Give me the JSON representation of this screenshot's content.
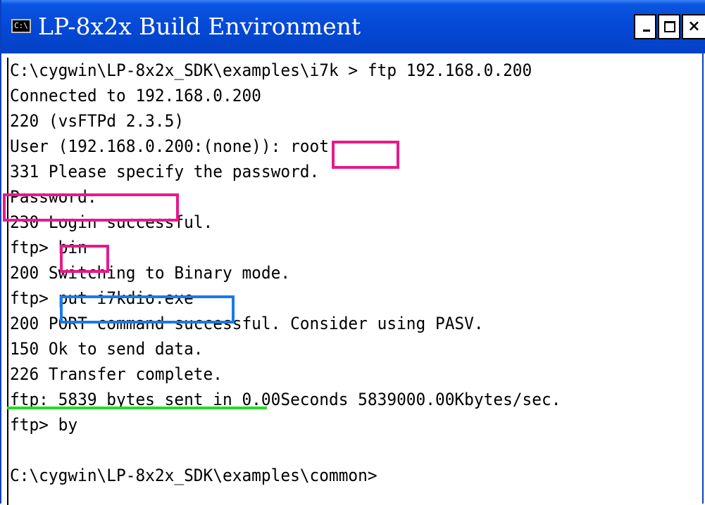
{
  "window": {
    "title": "LP-8x2x Build Environment",
    "icon": "console-icon",
    "icon_text": "C:\\",
    "buttons": {
      "minimize": "minimize-icon",
      "maximize": "maximize-icon",
      "close": "×"
    }
  },
  "terminal": {
    "lines": [
      "C:\\cygwin\\LP-8x2x_SDK\\examples\\i7k > ftp 192.168.0.200",
      "Connected to 192.168.0.200",
      "220 (vsFTPd 2.3.5)",
      "User (192.168.0.200:(none)): root",
      "331 Please specify the password.",
      "Password:",
      "230 Login successful.",
      "ftp> bin",
      "200 Switching to Binary mode.",
      "ftp> put i7kdio.exe",
      "200 PORT command successful. Consider using PASV.",
      "150 Ok to send data.",
      "226 Transfer complete.",
      "ftp: 5839 bytes sent in 0.00Seconds 5839000.00Kbytes/sec.",
      "ftp> by",
      "",
      "C:\\cygwin\\LP-8x2x_SDK\\examples\\common>"
    ]
  },
  "colors": {
    "titlebar": "#0548d6",
    "highlight_pink": "#e8198b",
    "highlight_blue": "#1a7ae8",
    "underline_green": "#22dd22"
  }
}
